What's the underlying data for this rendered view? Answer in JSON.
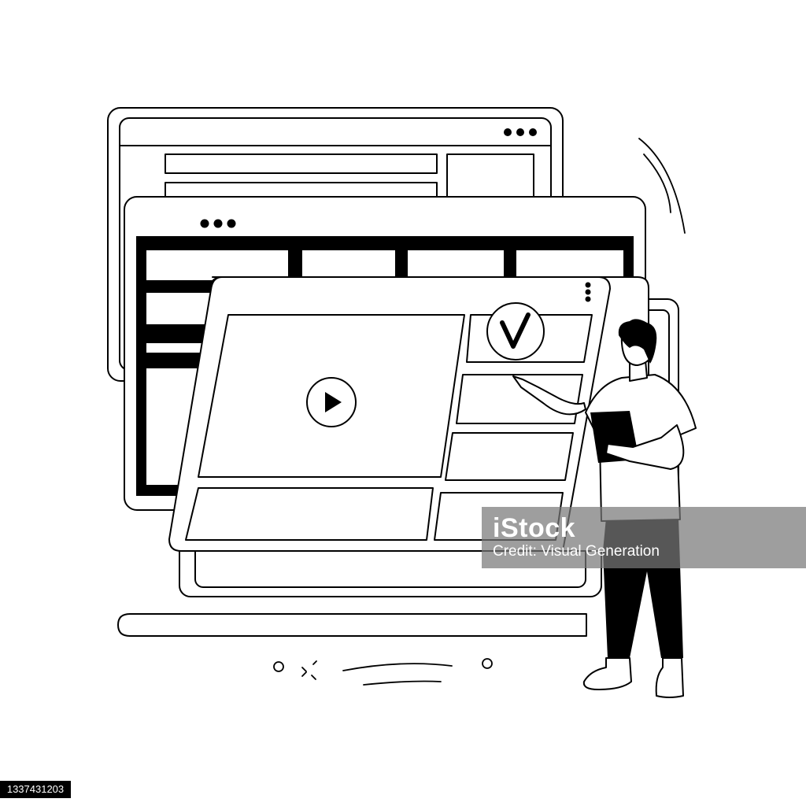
{
  "watermark": {
    "brand": "iStock",
    "credit": "Credit: Visual Generation"
  },
  "stock_id": "1337431203",
  "illustration": {
    "style": "black outline line-art",
    "icons": [
      "play-icon",
      "checkmark-icon",
      "window-dots-icon"
    ]
  },
  "colors": {
    "ink": "#000000",
    "paper": "#ffffff",
    "watermark_band": "#787878"
  }
}
